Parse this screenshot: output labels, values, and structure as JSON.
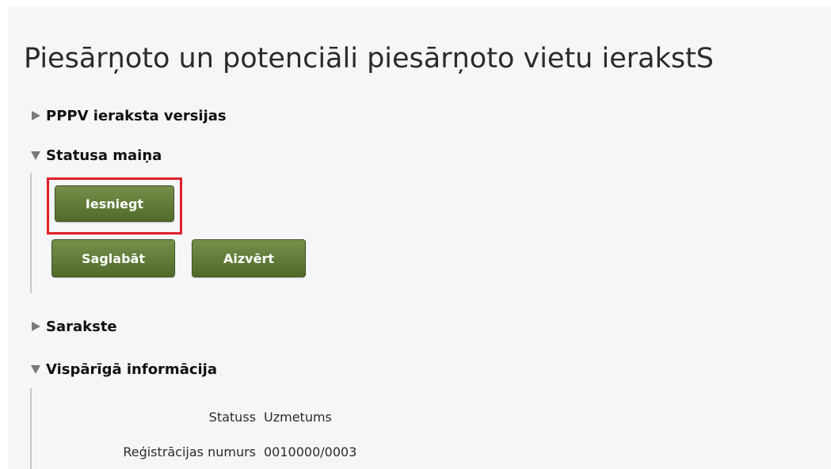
{
  "page": {
    "title": "Piesārņoto un potenciāli piesārņoto vietu ierakstS"
  },
  "sections": [
    {
      "label": "PPPV ieraksta versijas",
      "expanded": false
    },
    {
      "label": "Statusa maiņa",
      "expanded": true
    },
    {
      "label": "Sarakste",
      "expanded": false
    },
    {
      "label": "Vispārīgā informācija",
      "expanded": true
    }
  ],
  "status_change": {
    "submit_label": "Iesniegt",
    "save_label": "Saglabāt",
    "close_label": "Aizvērt"
  },
  "general_info": {
    "rows": [
      {
        "label": "Statuss",
        "value": "Uzmetums"
      },
      {
        "label": "Reģistrācijas numurs",
        "value": "0010000/0003"
      }
    ]
  },
  "colors": {
    "button": "#5f7a35",
    "highlight": "#e0202a",
    "section_line": "#c9c9c9"
  },
  "icons": {
    "collapsed": "triangle-right-icon",
    "expanded": "triangle-down-icon"
  }
}
